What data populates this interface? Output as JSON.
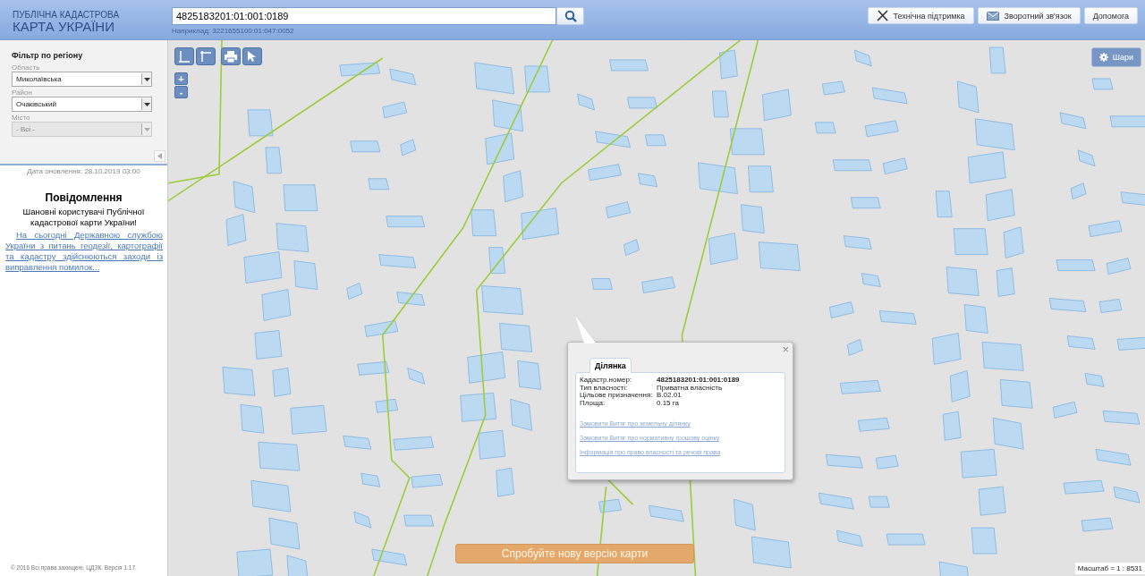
{
  "header": {
    "title_small": "ПУБЛІЧНА КАДАСТРОВА",
    "title_large": "КАРТА УКРАЇНИ",
    "search": {
      "value": "4825183201:01:001:0189",
      "hint": "Наприклад: 3221655100:01:047:0052"
    },
    "nav_buttons": [
      {
        "kind": "support",
        "label": "Технічна підтримка"
      },
      {
        "kind": "feedback",
        "label": "Зворотний зв'язок"
      },
      {
        "kind": "help",
        "label": "Допомога"
      }
    ]
  },
  "filter": {
    "title": "Фільтр по регіону",
    "fields": [
      {
        "label": "Область",
        "value": "Миколаївська",
        "disabled": false
      },
      {
        "label": "Район",
        "value": "Очаківський",
        "disabled": false
      },
      {
        "label": "Місто",
        "value": "- Всі -",
        "disabled": true
      }
    ]
  },
  "sidebar": {
    "update_date": "Дата оновлення: 28.10.2019 03:00",
    "notice_title": "Повідомлення",
    "notice_greeting": "Шановні користувачі Публічної кадастрової карти України!",
    "notice_link": "На сьогодні Державною службою України з питань геодезії, картографії та кадастру здійснюються заходи із виправлення помилок...",
    "copyright": "© 2016 Всі права захищені. ЦДЗК. Версія 1.17."
  },
  "map": {
    "tools": [
      {
        "kind": "distance"
      },
      {
        "kind": "area"
      },
      {
        "kind": "print"
      },
      {
        "kind": "identify"
      }
    ],
    "zoom": [
      "+",
      "-"
    ],
    "layers_button": "Шари",
    "popup": {
      "tab": "Ділянка",
      "close": "×",
      "rows": [
        {
          "label": "Кадастр.номер:",
          "value": "4825183201:01:001:0189",
          "bold": true
        },
        {
          "label": "Тип власності:",
          "value": "Приватна власність",
          "bold": false
        },
        {
          "label": "Цільове призначення:",
          "value": "В.02.01",
          "bold": false
        },
        {
          "label": "Площа:",
          "value": "0.15 га",
          "bold": false
        }
      ],
      "links": [
        "Замовити Витяг про земельну ділянку",
        "Замовити Витяг про нормативну грошову оцінку",
        "Інформація про право власності та речові права"
      ]
    },
    "new_version_button": "Спробуйте нову версію карти",
    "scale": "Масштаб = 1 : 8531"
  }
}
